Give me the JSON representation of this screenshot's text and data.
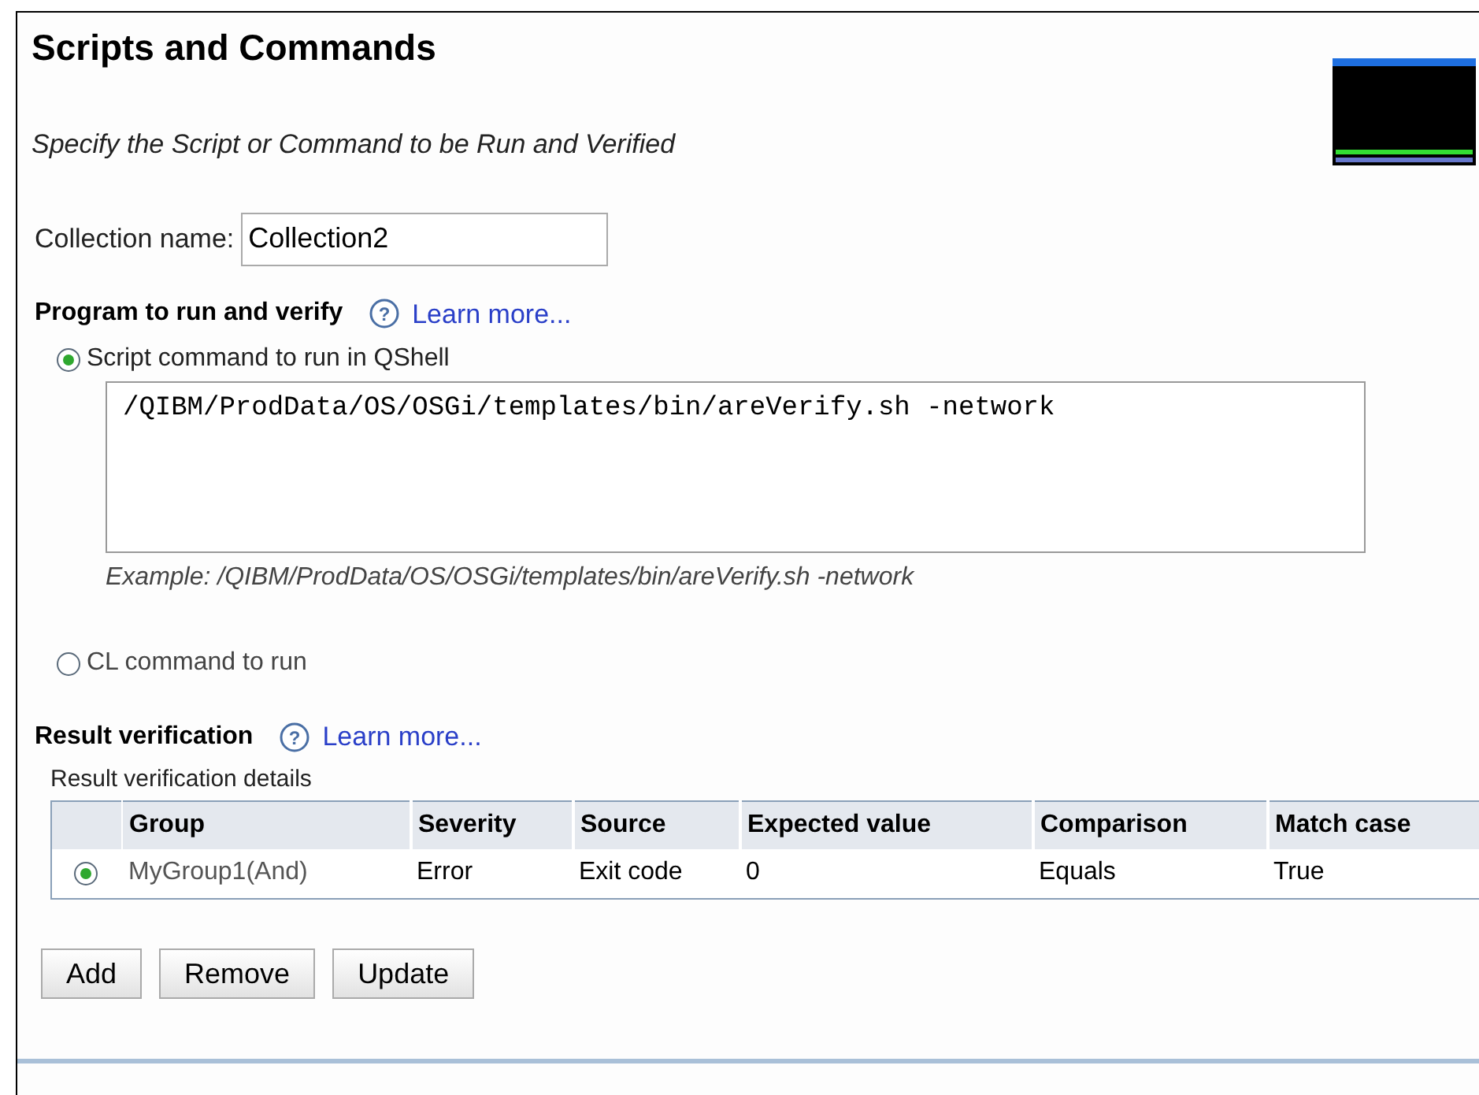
{
  "title": "Scripts and Commands",
  "subtitle": "Specify the Script or Command to be Run and Verified",
  "collection": {
    "label": "Collection name:",
    "value": "Collection2"
  },
  "program": {
    "heading": "Program to run and verify",
    "help_icon": "?",
    "learn_more": "Learn more...",
    "options": [
      {
        "label": "Script command to run in QShell",
        "selected": true,
        "command": "/QIBM/ProdData/OS/OSGi/templates/bin/areVerify.sh -network",
        "example": "Example: /QIBM/ProdData/OS/OSGi/templates/bin/areVerify.sh -network"
      },
      {
        "label": "CL command to run",
        "selected": false
      }
    ]
  },
  "verification": {
    "heading": "Result verification",
    "help_icon": "?",
    "learn_more": "Learn more...",
    "details_label": "Result verification details",
    "columns": [
      "Group",
      "Severity",
      "Source",
      "Expected value",
      "Comparison",
      "Match case"
    ],
    "rows": [
      {
        "selected": true,
        "cells": [
          "MyGroup1(And)",
          "Error",
          "Exit code",
          "0",
          "Equals",
          "True"
        ]
      }
    ]
  },
  "buttons": [
    "Add",
    "Remove",
    "Update"
  ]
}
